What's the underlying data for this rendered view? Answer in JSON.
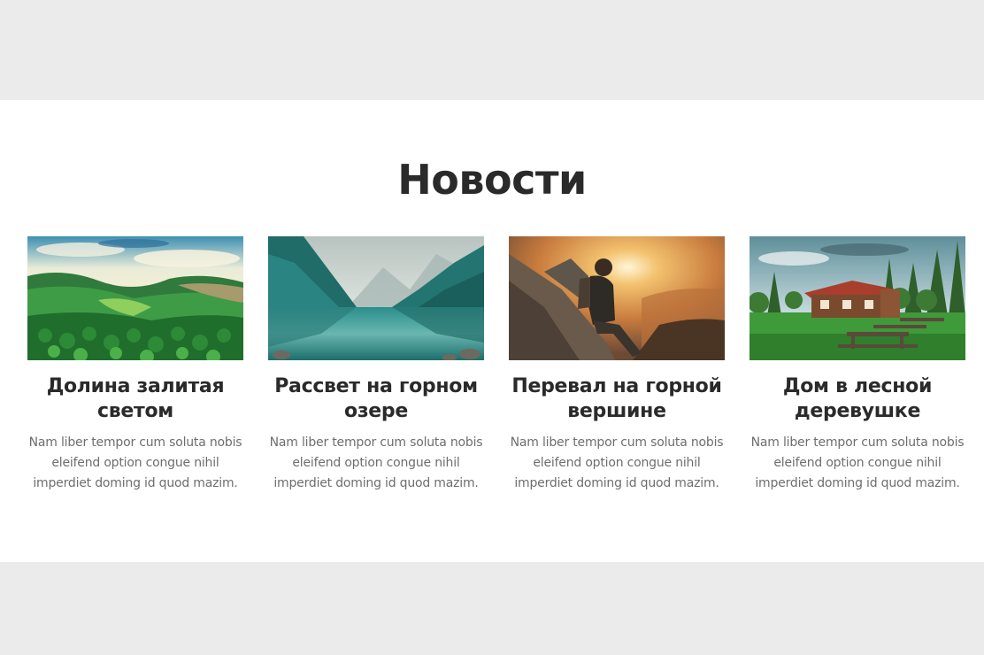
{
  "section": {
    "title": "Новости",
    "cards": [
      {
        "image": "green-valley-image",
        "title": "Долина залитая светом",
        "text": "Nam liber tempor cum soluta nobis eleifend option congue nihil imperdiet doming id quod mazim."
      },
      {
        "image": "mountain-lake-image",
        "title": "Рассвет на горном озере",
        "text": "Nam liber tempor cum soluta nobis eleifend option congue nihil imperdiet doming id quod mazim."
      },
      {
        "image": "hiker-summit-image",
        "title": "Перевал на горной вершине",
        "text": "Nam liber tempor cum soluta nobis eleifend option congue nihil imperdiet doming id quod mazim."
      },
      {
        "image": "forest-cabin-image",
        "title": "Дом в лесной деревушке",
        "text": "Nam liber tempor cum soluta nobis eleifend option congue nihil imperdiet doming id quod mazim."
      }
    ]
  },
  "colors": {
    "page_band": "#ebebeb",
    "section_background": "#ffffff",
    "heading": "#2a2a2a",
    "body_text": "#6e6e6e"
  }
}
